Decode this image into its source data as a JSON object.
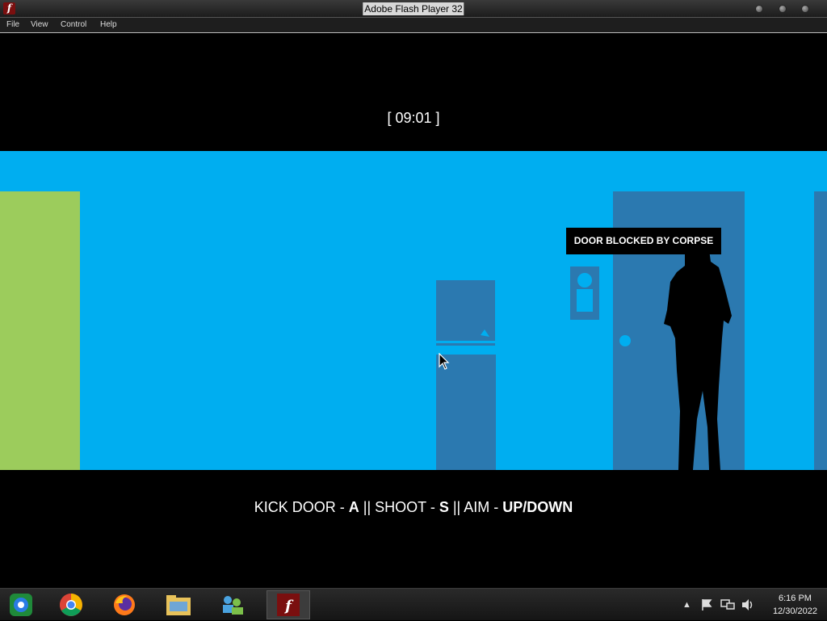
{
  "window": {
    "title": "Adobe Flash Player 32",
    "icon": "flash-player-icon"
  },
  "menu": {
    "items": [
      "File",
      "View",
      "Control",
      "Help"
    ]
  },
  "game": {
    "timer": "[ 09:01 ]",
    "tooltip": "DOOR BLOCKED BY CORPSE",
    "controls": {
      "kick_label": "KICK DOOR - ",
      "kick_key": "A",
      "sep1": " || SHOOT - ",
      "shoot_key": "S",
      "sep2": " || AIM - ",
      "aim_key": "UP/DOWN"
    },
    "colors": {
      "hall": "#00aef0",
      "door": "#2b79b0",
      "green_door": "#9ccc5c"
    }
  },
  "taskbar": {
    "apps": [
      "ie-icon",
      "chrome-icon",
      "firefox-icon",
      "file-explorer-icon",
      "network-app-icon",
      "flash-player-icon"
    ],
    "tray": [
      "show-hidden-icons",
      "flag-icon",
      "network-icon",
      "volume-icon"
    ],
    "time": "6:16 PM",
    "date": "12/30/2022"
  }
}
